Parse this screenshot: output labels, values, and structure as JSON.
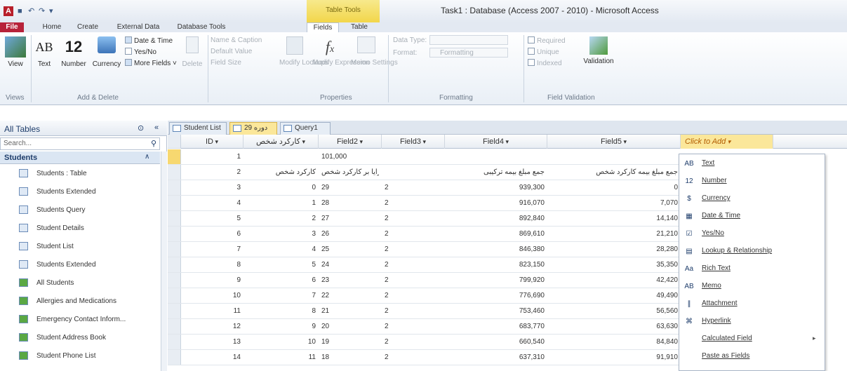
{
  "window": {
    "app_icon": "A",
    "qat_save": "■",
    "qat_undo": "↶",
    "qat_redo": "↷",
    "qat_more": "▾",
    "context_group": "Table Tools",
    "title": "Task1 : Database (Access 2007 - 2010) - Microsoft Access"
  },
  "tabs": {
    "file": "File",
    "home": "Home",
    "create": "Create",
    "external_data": "External Data",
    "database_tools": "Database Tools",
    "fields": "Fields",
    "table": "Table"
  },
  "ribbon": {
    "view": "View",
    "views_group": "Views",
    "text_icon": "AB",
    "text": "Text",
    "number_icon": "12",
    "number": "Number",
    "currency": "Currency",
    "date_time": "Date & Time",
    "yes_no": "Yes/No",
    "more_fields": "More Fields ˅",
    "delete": "Delete",
    "add_delete_group": "Add & Delete",
    "name_caption": "Name & Caption",
    "default_value": "Default Value",
    "field_size": "Field Size",
    "modify_lookups": "Modify Lookups",
    "modify_expression": "Modify Expression",
    "memo_settings": "Memo Settings",
    "properties_group": "Properties",
    "data_type": "Data Type:",
    "format": "Format:",
    "formatting": "Formatting",
    "formatting_group": "Formatting",
    "required": "Required",
    "unique": "Unique",
    "indexed": "Indexed",
    "validation": "Validation",
    "field_validation_group": "Field Validation"
  },
  "nav": {
    "title": "All Tables",
    "search_placeholder": "Search...",
    "group": "Students",
    "items": [
      {
        "label": "Students : Table"
      },
      {
        "label": "Students Extended"
      },
      {
        "label": "Students Query"
      },
      {
        "label": "Student Details"
      },
      {
        "label": "Student List"
      },
      {
        "label": "Students Extended"
      },
      {
        "label": "All Students"
      },
      {
        "label": "Allergies and Medications"
      },
      {
        "label": "Emergency Contact Inform..."
      },
      {
        "label": "Student Address Book"
      },
      {
        "label": "Student Phone List"
      }
    ]
  },
  "doc_tabs": [
    {
      "label": "Student List"
    },
    {
      "label": "دوره 29"
    },
    {
      "label": "Query1"
    }
  ],
  "grid": {
    "headers": [
      "ID",
      "کارکرد شخص",
      "Field2",
      "Field3",
      "Field4",
      "Field5"
    ],
    "sort_arrow": "▾",
    "click_to_add": "Click to Add",
    "rows": [
      [
        "1",
        "",
        "101,000",
        "",
        "",
        ""
      ],
      [
        "2",
        "کارکرد شخص",
        "مزایا بر کارکرد شخص",
        "",
        "جمع مبلغ بیمه ترکیبی",
        "جمع مبلغ بیمه کارکرد شخص"
      ],
      [
        "3",
        "0",
        "29",
        "2",
        "939,300",
        "0"
      ],
      [
        "4",
        "1",
        "28",
        "2",
        "916,070",
        "7,070"
      ],
      [
        "5",
        "2",
        "27",
        "2",
        "892,840",
        "14,140"
      ],
      [
        "6",
        "3",
        "26",
        "2",
        "869,610",
        "21,210"
      ],
      [
        "7",
        "4",
        "25",
        "2",
        "846,380",
        "28,280"
      ],
      [
        "8",
        "5",
        "24",
        "2",
        "823,150",
        "35,350"
      ],
      [
        "9",
        "6",
        "23",
        "2",
        "799,920",
        "42,420"
      ],
      [
        "10",
        "7",
        "22",
        "2",
        "776,690",
        "49,490"
      ],
      [
        "11",
        "8",
        "21",
        "2",
        "753,460",
        "56,560"
      ],
      [
        "12",
        "9",
        "20",
        "2",
        "683,770",
        "63,630"
      ],
      [
        "13",
        "10",
        "19",
        "2",
        "660,540",
        "84,840"
      ],
      [
        "14",
        "11",
        "18",
        "2",
        "637,310",
        "91,910"
      ]
    ]
  },
  "dropdown": {
    "items": [
      {
        "icon": "AB",
        "label": "Text"
      },
      {
        "icon": "12",
        "label": "Number"
      },
      {
        "icon": "$",
        "label": "Currency"
      },
      {
        "icon": "▦",
        "label": "Date & Time"
      },
      {
        "icon": "☑",
        "label": "Yes/No"
      },
      {
        "icon": "▤",
        "label": "Lookup & Relationship"
      },
      {
        "icon": "Aa",
        "label": "Rich Text"
      },
      {
        "icon": "AB",
        "label": "Memo"
      },
      {
        "icon": "∥",
        "label": "Attachment"
      },
      {
        "icon": "⌘",
        "label": "Hyperlink"
      },
      {
        "icon": "",
        "label": "Calculated Field"
      },
      {
        "icon": "",
        "label": "Paste as Fields"
      }
    ],
    "submenu_arrow": "▸"
  }
}
